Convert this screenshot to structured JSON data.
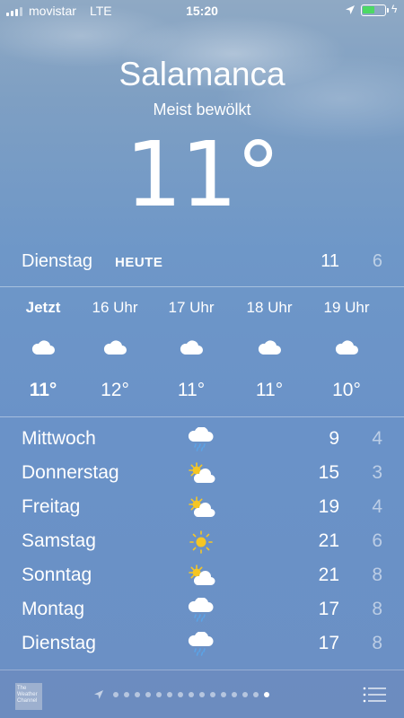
{
  "status_bar": {
    "carrier": "movistar",
    "network": "LTE",
    "time": "15:20",
    "battery_level": 0.55,
    "battery_color": "#4cd964"
  },
  "location": {
    "city": "Salamanca",
    "condition": "Meist bewölkt",
    "temperature": "11°"
  },
  "today": {
    "day": "Dienstag",
    "tag": "HEUTE",
    "high": "11",
    "low": "6"
  },
  "hourly": [
    {
      "label": "Jetzt",
      "icon": "cloud-icon",
      "temp": "11°"
    },
    {
      "label": "16 Uhr",
      "icon": "cloud-icon",
      "temp": "12°"
    },
    {
      "label": "17 Uhr",
      "icon": "cloud-icon",
      "temp": "11°"
    },
    {
      "label": "18 Uhr",
      "icon": "cloud-icon",
      "temp": "11°"
    },
    {
      "label": "19 Uhr",
      "icon": "cloud-icon",
      "temp": "10°"
    }
  ],
  "hourly_overflow": "S",
  "daily": [
    {
      "day": "Mittwoch",
      "icon": "cloud-rain-icon",
      "high": "9",
      "low": "4"
    },
    {
      "day": "Donnerstag",
      "icon": "partly-cloudy-icon",
      "high": "15",
      "low": "3"
    },
    {
      "day": "Freitag",
      "icon": "partly-cloudy-icon",
      "high": "19",
      "low": "4"
    },
    {
      "day": "Samstag",
      "icon": "sun-icon",
      "high": "21",
      "low": "6"
    },
    {
      "day": "Sonntag",
      "icon": "partly-cloudy-icon",
      "high": "21",
      "low": "8"
    },
    {
      "day": "Montag",
      "icon": "cloud-rain-icon",
      "high": "17",
      "low": "8"
    },
    {
      "day": "Dienstag",
      "icon": "cloud-rain-icon",
      "high": "17",
      "low": "8"
    }
  ],
  "toolbar": {
    "logo_text": "The Weather Channel",
    "page_count": 15,
    "active_page": 14
  },
  "colors": {
    "sun": "#f6c623",
    "rain": "#5ba3e6"
  }
}
